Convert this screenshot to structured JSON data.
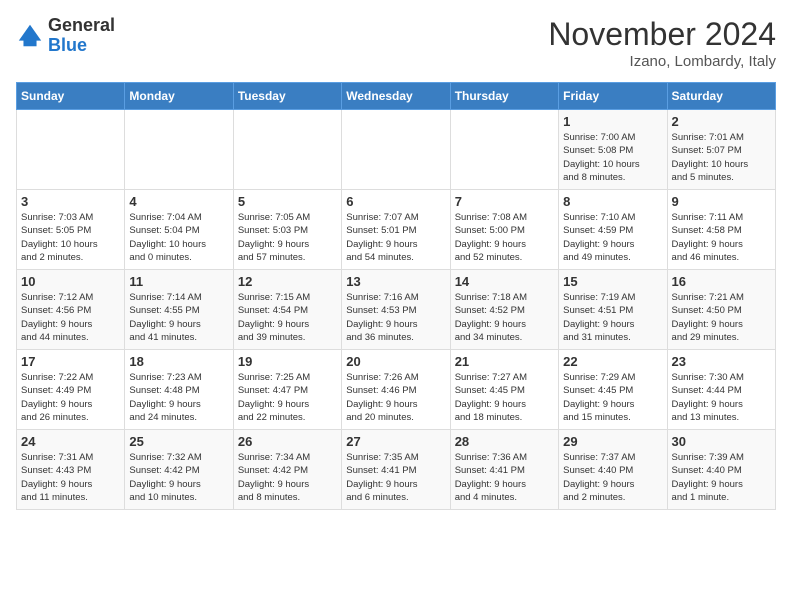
{
  "header": {
    "logo_general": "General",
    "logo_blue": "Blue",
    "month_title": "November 2024",
    "location": "Izano, Lombardy, Italy"
  },
  "weekdays": [
    "Sunday",
    "Monday",
    "Tuesday",
    "Wednesday",
    "Thursday",
    "Friday",
    "Saturday"
  ],
  "weeks": [
    [
      {
        "day": "",
        "info": ""
      },
      {
        "day": "",
        "info": ""
      },
      {
        "day": "",
        "info": ""
      },
      {
        "day": "",
        "info": ""
      },
      {
        "day": "",
        "info": ""
      },
      {
        "day": "1",
        "info": "Sunrise: 7:00 AM\nSunset: 5:08 PM\nDaylight: 10 hours\nand 8 minutes."
      },
      {
        "day": "2",
        "info": "Sunrise: 7:01 AM\nSunset: 5:07 PM\nDaylight: 10 hours\nand 5 minutes."
      }
    ],
    [
      {
        "day": "3",
        "info": "Sunrise: 7:03 AM\nSunset: 5:05 PM\nDaylight: 10 hours\nand 2 minutes."
      },
      {
        "day": "4",
        "info": "Sunrise: 7:04 AM\nSunset: 5:04 PM\nDaylight: 10 hours\nand 0 minutes."
      },
      {
        "day": "5",
        "info": "Sunrise: 7:05 AM\nSunset: 5:03 PM\nDaylight: 9 hours\nand 57 minutes."
      },
      {
        "day": "6",
        "info": "Sunrise: 7:07 AM\nSunset: 5:01 PM\nDaylight: 9 hours\nand 54 minutes."
      },
      {
        "day": "7",
        "info": "Sunrise: 7:08 AM\nSunset: 5:00 PM\nDaylight: 9 hours\nand 52 minutes."
      },
      {
        "day": "8",
        "info": "Sunrise: 7:10 AM\nSunset: 4:59 PM\nDaylight: 9 hours\nand 49 minutes."
      },
      {
        "day": "9",
        "info": "Sunrise: 7:11 AM\nSunset: 4:58 PM\nDaylight: 9 hours\nand 46 minutes."
      }
    ],
    [
      {
        "day": "10",
        "info": "Sunrise: 7:12 AM\nSunset: 4:56 PM\nDaylight: 9 hours\nand 44 minutes."
      },
      {
        "day": "11",
        "info": "Sunrise: 7:14 AM\nSunset: 4:55 PM\nDaylight: 9 hours\nand 41 minutes."
      },
      {
        "day": "12",
        "info": "Sunrise: 7:15 AM\nSunset: 4:54 PM\nDaylight: 9 hours\nand 39 minutes."
      },
      {
        "day": "13",
        "info": "Sunrise: 7:16 AM\nSunset: 4:53 PM\nDaylight: 9 hours\nand 36 minutes."
      },
      {
        "day": "14",
        "info": "Sunrise: 7:18 AM\nSunset: 4:52 PM\nDaylight: 9 hours\nand 34 minutes."
      },
      {
        "day": "15",
        "info": "Sunrise: 7:19 AM\nSunset: 4:51 PM\nDaylight: 9 hours\nand 31 minutes."
      },
      {
        "day": "16",
        "info": "Sunrise: 7:21 AM\nSunset: 4:50 PM\nDaylight: 9 hours\nand 29 minutes."
      }
    ],
    [
      {
        "day": "17",
        "info": "Sunrise: 7:22 AM\nSunset: 4:49 PM\nDaylight: 9 hours\nand 26 minutes."
      },
      {
        "day": "18",
        "info": "Sunrise: 7:23 AM\nSunset: 4:48 PM\nDaylight: 9 hours\nand 24 minutes."
      },
      {
        "day": "19",
        "info": "Sunrise: 7:25 AM\nSunset: 4:47 PM\nDaylight: 9 hours\nand 22 minutes."
      },
      {
        "day": "20",
        "info": "Sunrise: 7:26 AM\nSunset: 4:46 PM\nDaylight: 9 hours\nand 20 minutes."
      },
      {
        "day": "21",
        "info": "Sunrise: 7:27 AM\nSunset: 4:45 PM\nDaylight: 9 hours\nand 18 minutes."
      },
      {
        "day": "22",
        "info": "Sunrise: 7:29 AM\nSunset: 4:45 PM\nDaylight: 9 hours\nand 15 minutes."
      },
      {
        "day": "23",
        "info": "Sunrise: 7:30 AM\nSunset: 4:44 PM\nDaylight: 9 hours\nand 13 minutes."
      }
    ],
    [
      {
        "day": "24",
        "info": "Sunrise: 7:31 AM\nSunset: 4:43 PM\nDaylight: 9 hours\nand 11 minutes."
      },
      {
        "day": "25",
        "info": "Sunrise: 7:32 AM\nSunset: 4:42 PM\nDaylight: 9 hours\nand 10 minutes."
      },
      {
        "day": "26",
        "info": "Sunrise: 7:34 AM\nSunset: 4:42 PM\nDaylight: 9 hours\nand 8 minutes."
      },
      {
        "day": "27",
        "info": "Sunrise: 7:35 AM\nSunset: 4:41 PM\nDaylight: 9 hours\nand 6 minutes."
      },
      {
        "day": "28",
        "info": "Sunrise: 7:36 AM\nSunset: 4:41 PM\nDaylight: 9 hours\nand 4 minutes."
      },
      {
        "day": "29",
        "info": "Sunrise: 7:37 AM\nSunset: 4:40 PM\nDaylight: 9 hours\nand 2 minutes."
      },
      {
        "day": "30",
        "info": "Sunrise: 7:39 AM\nSunset: 4:40 PM\nDaylight: 9 hours\nand 1 minute."
      }
    ]
  ]
}
